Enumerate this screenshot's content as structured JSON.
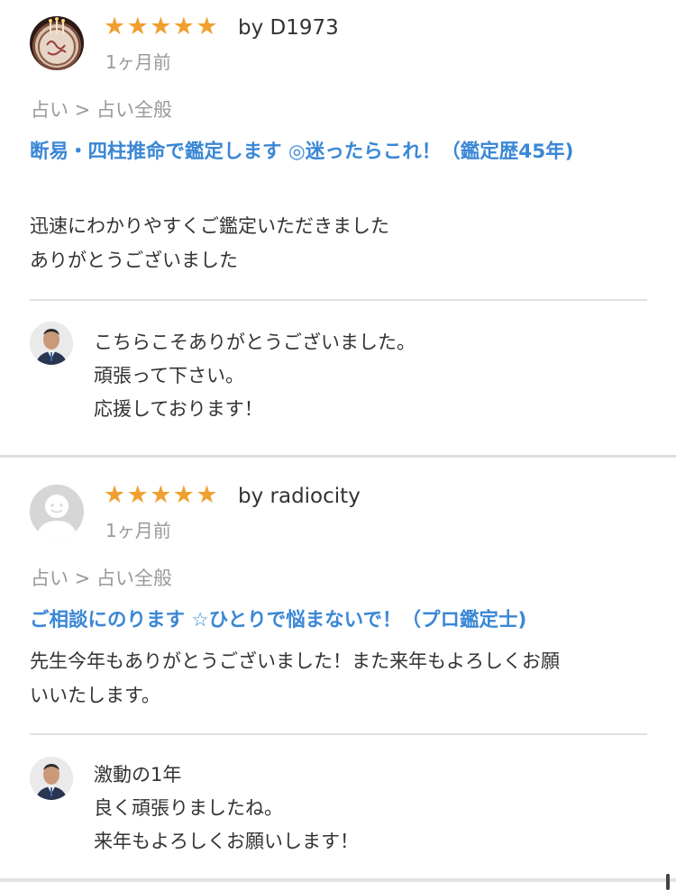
{
  "reviews": [
    {
      "reviewer": "by D1973",
      "rating": 5,
      "stars": [
        "★",
        "★",
        "★",
        "★",
        "★"
      ],
      "time_ago": "1ヶ月前",
      "category": "占い > 占い全般",
      "service_title": "断易・四柱推命で鑑定します ◎迷ったらこれ！（鑑定歴45年)",
      "comment_lines": [
        "迅速にわかりやすくご鑑定いただきました",
        "ありがとうございました"
      ],
      "reply_lines": [
        "こちらこそありがとうございました。",
        "頑張って下さい。",
        "応援しております！"
      ]
    },
    {
      "reviewer": "by radiocity",
      "rating": 5,
      "stars": [
        "★",
        "★",
        "★",
        "★",
        "★"
      ],
      "time_ago": "1ヶ月前",
      "category": "占い > 占い全般",
      "service_title": "ご相談にのります ☆ひとりで悩まないで！（プロ鑑定士)",
      "comment_lines": [
        "先生今年もありがとうございました！また来年もよろしくお願",
        "いいたします。"
      ],
      "reply_lines": [
        "激動の1年",
        "良く頑張りましたね。",
        "来年もよろしくお願いします！"
      ]
    }
  ],
  "colors": {
    "star": "#f0a030",
    "link": "#3a87d6",
    "muted": "#999999",
    "text": "#333333"
  }
}
